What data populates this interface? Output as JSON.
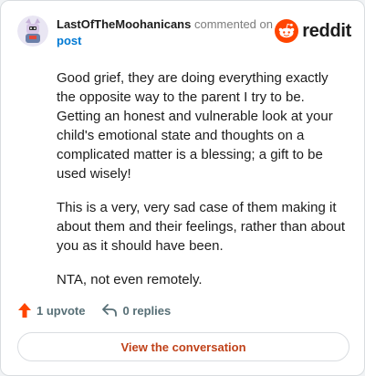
{
  "comment": {
    "author": "LastOfTheMoohanicans",
    "action_text": "commented on",
    "target_link": "post",
    "paragraphs": [
      "Good grief, they are doing everything exactly the opposite way to the parent I try to be. Getting an honest and vulnerable look at your child's emotional state and thoughts on a complicated matter is a blessing; a gift to be used wisely!",
      "This is a very, very sad case of them making it about them and their feelings, rather than about you as it should have been.",
      "NTA, not even remotely."
    ]
  },
  "brand": {
    "wordmark": "reddit",
    "color": "#ff4500"
  },
  "actions": {
    "upvotes": "1 upvote",
    "replies": "0 replies",
    "upvote_color": "#ff4500"
  },
  "cta": {
    "label": "View the conversation"
  },
  "icons": [
    "avatar",
    "reddit-logo-icon",
    "upvote-arrow-icon",
    "reply-icon"
  ]
}
